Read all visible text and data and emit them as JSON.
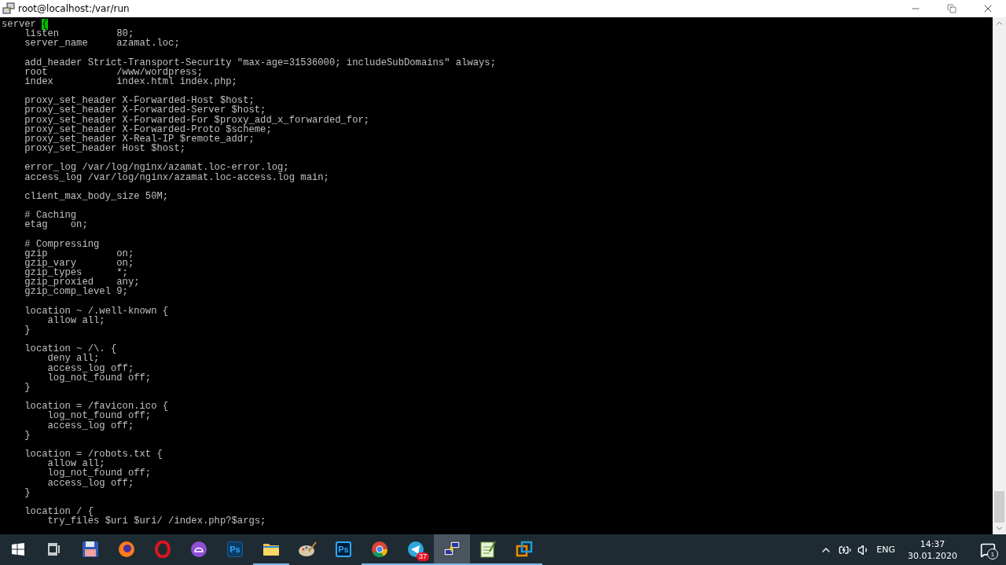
{
  "window": {
    "title": "root@localhost:/var/run"
  },
  "terminal": {
    "cursor": true,
    "blocks": [
      [
        "server {",
        "    listen          80;",
        "    server_name     azamat.loc;"
      ],
      [
        "    add_header Strict-Transport-Security \"max-age=31536000; includeSubDomains\" always;",
        "    root            /www/wordpress;",
        "    index           index.html index.php;"
      ],
      [
        "    proxy_set_header X-Forwarded-Host $host;",
        "    proxy_set_header X-Forwarded-Server $host;",
        "    proxy_set_header X-Forwarded-For $proxy_add_x_forwarded_for;",
        "    proxy_set_header X-Forwarded-Proto $scheme;",
        "    proxy_set_header X-Real-IP $remote_addr;",
        "    proxy_set_header Host $host;"
      ],
      [
        "    error_log /var/log/nginx/azamat.loc-error.log;",
        "    access_log /var/log/nginx/azamat.loc-access.log main;"
      ],
      [
        "    client_max_body_size 50M;"
      ],
      [
        "    # Caching",
        "    etag    on;"
      ],
      [
        "    # Compressing",
        "    gzip            on;",
        "    gzip_vary       on;",
        "    gzip_types      *;",
        "    gzip_proxied    any;",
        "    gzip_comp_level 9;"
      ],
      [
        "    location ~ /.well-known {",
        "        allow all;",
        "    }"
      ],
      [
        "    location ~ /\\. {",
        "        deny all;",
        "        access_log off;",
        "        log_not_found off;",
        "    }"
      ],
      [
        "    location = /favicon.ico {",
        "        log_not_found off;",
        "        access_log off;",
        "    }"
      ],
      [
        "    location = /robots.txt {",
        "        allow all;",
        "        log_not_found off;",
        "        access_log off;",
        "    }"
      ],
      [
        "    location / {",
        "        try_files $uri $uri/ /index.php?$args;"
      ]
    ]
  },
  "taskbar": {
    "buttons": [
      {
        "kind": "start",
        "running": false,
        "selected": false
      },
      {
        "kind": "taskview",
        "running": false,
        "selected": false
      },
      {
        "kind": "floppy",
        "running": false,
        "selected": false
      },
      {
        "kind": "fox",
        "running": false,
        "selected": false
      },
      {
        "kind": "ring",
        "running": false,
        "selected": false
      },
      {
        "kind": "chat",
        "running": false,
        "selected": false
      },
      {
        "kind": "ps",
        "label": "Ps",
        "running": false,
        "selected": false
      },
      {
        "kind": "folder",
        "running": true,
        "selected": false
      },
      {
        "kind": "palette",
        "running": false,
        "selected": false
      },
      {
        "kind": "psoutline",
        "label": "Ps",
        "running": false,
        "selected": false
      },
      {
        "kind": "chrome",
        "running": true,
        "selected": false
      },
      {
        "kind": "plane",
        "badge": "37",
        "running": true,
        "selected": false
      },
      {
        "kind": "computers",
        "running": true,
        "selected": true
      },
      {
        "kind": "notepad",
        "running": true,
        "selected": false
      },
      {
        "kind": "squares",
        "running": true,
        "selected": false
      }
    ],
    "tray": {
      "language": "ENG",
      "time": "14:37",
      "date": "30.01.2020",
      "notifications": "1"
    }
  }
}
